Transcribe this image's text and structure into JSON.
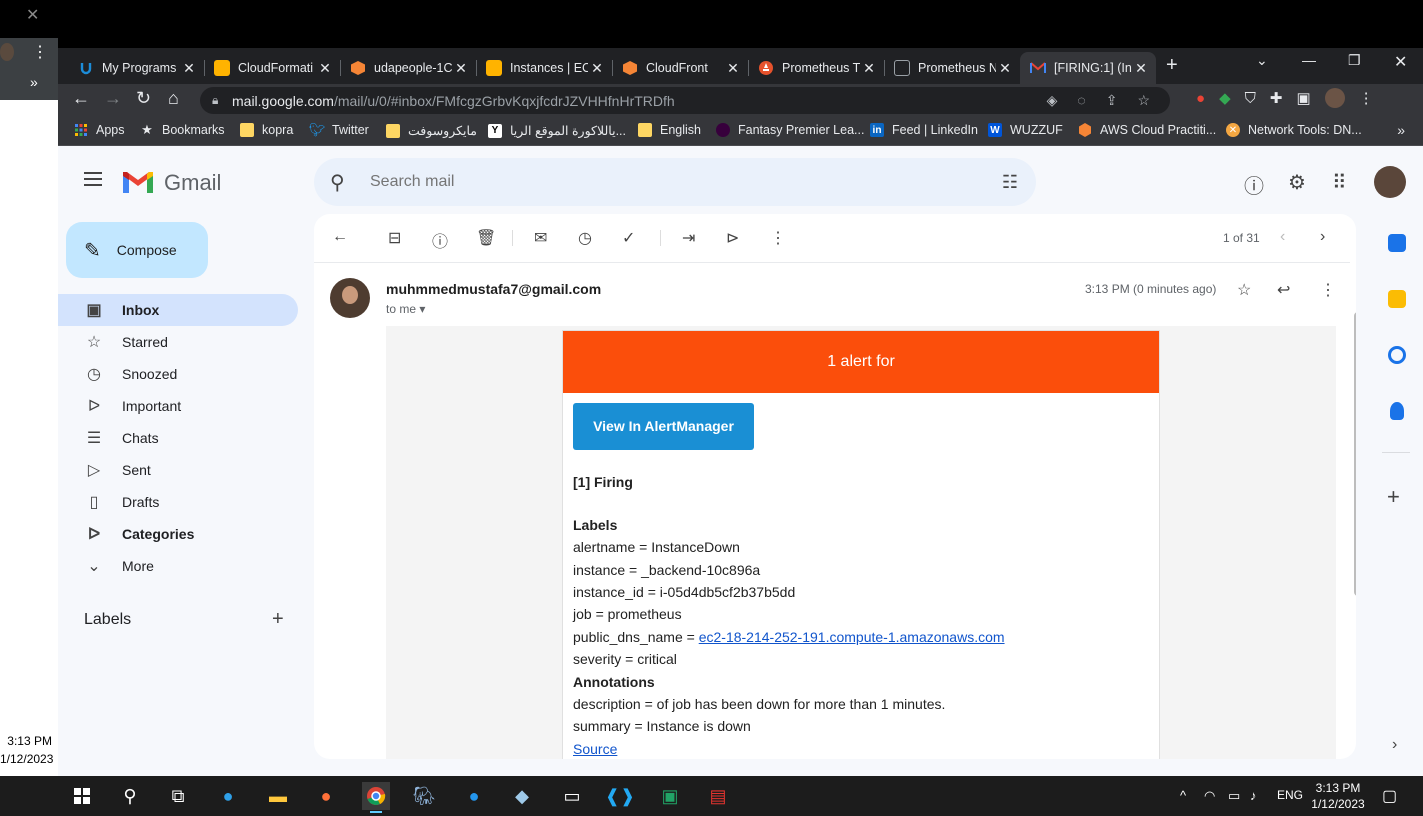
{
  "desktop": {
    "bg_close": "✕",
    "bg_menu": "⋮",
    "bg_chevron": "»",
    "bg_clock_time": "3:13 PM",
    "bg_clock_date": "1/12/2023"
  },
  "browser": {
    "tabs": [
      {
        "label": "My Programs",
        "icon": "udacity-icon",
        "color": "#1c8cd8"
      },
      {
        "label": "CloudFormati",
        "icon": "aws-box-icon",
        "color": "#ffb300"
      },
      {
        "label": "udapeople-1C",
        "icon": "aws-hex-icon",
        "color": "#f58536"
      },
      {
        "label": "Instances | EC",
        "icon": "aws-box-icon",
        "color": "#ffb300"
      },
      {
        "label": "CloudFront",
        "icon": "aws-hex-icon",
        "color": "#f58536"
      },
      {
        "label": "Prometheus T",
        "icon": "prometheus-icon",
        "color": "#e6522c"
      },
      {
        "label": "Prometheus N",
        "icon": "page-icon",
        "color": "#9aa0a6"
      },
      {
        "label": "[FIRING:1] (In",
        "icon": "gmail-icon",
        "color": "#ea4335"
      }
    ],
    "url_prefix": "mail.google.com",
    "url_rest": "/mail/u/0/#inbox/FMfcgzGrbvKqxjfcdrJZVHHfnHrTRDfh",
    "bookmarks": [
      {
        "label": "Apps",
        "icon": "apps-grid-icon",
        "color": "#4285f4"
      },
      {
        "label": "Bookmarks",
        "icon": "star-icon",
        "color": "#e8eaed"
      },
      {
        "label": "kopra",
        "icon": "folder-icon",
        "color": "#fdd663"
      },
      {
        "label": "Twitter",
        "icon": "twitter-icon",
        "color": "#1d9bf0"
      },
      {
        "label": "مايكروسوفت",
        "icon": "folder-icon",
        "color": "#fdd663"
      },
      {
        "label": "ياللاكورة الموقع الريا...",
        "icon": "yallakora-icon",
        "color": "#000000"
      },
      {
        "label": "English",
        "icon": "folder-icon",
        "color": "#fdd663"
      },
      {
        "label": "Fantasy Premier Lea...",
        "icon": "premier-league-icon",
        "color": "#37003c"
      },
      {
        "label": "Feed | LinkedIn",
        "icon": "linkedin-icon",
        "color": "#0a66c2"
      },
      {
        "label": "WUZZUF",
        "icon": "wuzzuf-icon",
        "color": "#0055d9"
      },
      {
        "label": "AWS Cloud Practiti...",
        "icon": "aws-hex-icon",
        "color": "#f58536"
      },
      {
        "label": "Network Tools: DN...",
        "icon": "network-tools-icon",
        "color": "#f4a742"
      }
    ],
    "bookmarks_more": "»"
  },
  "gmail": {
    "product_name": "Gmail",
    "search_placeholder": "Search mail",
    "compose_label": "Compose",
    "nav": [
      {
        "label": "Inbox",
        "icon": "inbox-icon",
        "glyph": "▣"
      },
      {
        "label": "Starred",
        "icon": "star-outline-icon",
        "glyph": "☆"
      },
      {
        "label": "Snoozed",
        "icon": "clock-icon",
        "glyph": "◷"
      },
      {
        "label": "Important",
        "icon": "important-icon",
        "glyph": "ᐅ"
      },
      {
        "label": "Chats",
        "icon": "chat-icon",
        "glyph": "☰"
      },
      {
        "label": "Sent",
        "icon": "send-icon",
        "glyph": "▷"
      },
      {
        "label": "Drafts",
        "icon": "draft-icon",
        "glyph": "▯"
      },
      {
        "label": "Categories",
        "icon": "label-icon",
        "glyph": "ᐅ"
      },
      {
        "label": "More",
        "icon": "chevron-down-icon",
        "glyph": "⌄"
      }
    ],
    "labels_heading": "Labels",
    "pager_text": "1 of 31",
    "message": {
      "sender": "muhmmedmustafa7@gmail.com",
      "to_line": "to me ▾",
      "time": "3:13 PM (0 minutes ago)"
    },
    "alert": {
      "header": "1 alert for",
      "button": "View In AlertManager",
      "firing": "[1] Firing",
      "labels_title": "Labels",
      "alertname": "alertname = InstanceDown",
      "instance": "instance = _backend-10c896a",
      "instance_id": "instance_id = i-05d4db5cf2b37b5dd",
      "job": "job = prometheus",
      "public_dns_prefix": "public_dns_name = ",
      "public_dns_link": "ec2-18-214-252-191.compute-1.amazonaws.com",
      "severity": "severity = critical",
      "annotations_title": "Annotations",
      "description": "description = of job has been down for more than 1 minutes.",
      "summary": "summary = Instance is down",
      "source": "Source"
    }
  },
  "taskbar": {
    "language": "ENG",
    "time": "3:13 PM",
    "date": "1/12/2023"
  }
}
